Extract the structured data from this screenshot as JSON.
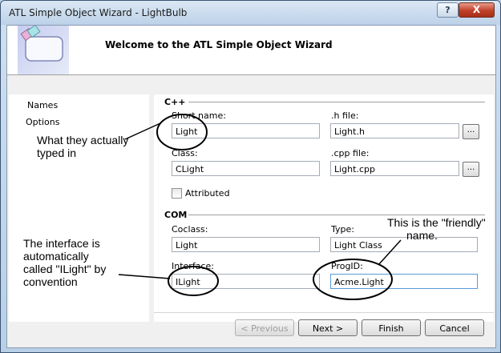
{
  "window": {
    "title": "ATL Simple Object Wizard - LightBulb",
    "help_label": "?",
    "close_label": "X"
  },
  "banner": {
    "title": "Welcome to the ATL Simple Object Wizard"
  },
  "nav": {
    "items": [
      "Names",
      "Options"
    ]
  },
  "cpp": {
    "section": "C++",
    "short_name": {
      "label": "Short name:",
      "value": "Light"
    },
    "h_file": {
      "label": ".h file:",
      "value": "Light.h",
      "browse": "..."
    },
    "class": {
      "label": "Class:",
      "value": "CLight"
    },
    "cpp_file": {
      "label": ".cpp file:",
      "value": "Light.cpp",
      "browse": "..."
    },
    "attributed": {
      "label": "Attributed",
      "checked": false
    }
  },
  "com": {
    "section": "COM",
    "coclass": {
      "label": "Coclass:",
      "value": "Light"
    },
    "type": {
      "label": "Type:",
      "value": "Light Class"
    },
    "interface": {
      "label": "Interface:",
      "value": "ILight"
    },
    "progid": {
      "label": "ProgID:",
      "value": "Acme.Light"
    }
  },
  "buttons": {
    "previous": "< Previous",
    "next": "Next >",
    "finish": "Finish",
    "cancel": "Cancel"
  },
  "annotations": {
    "typed": [
      "What they actually",
      "typed in"
    ],
    "friendly": [
      "This is the \"friendly\"",
      "name."
    ],
    "interface": [
      "The interface is",
      "automatically",
      "called \"ILight\" by",
      "convention"
    ]
  },
  "colors": {
    "annotation_ink": "#000000",
    "close_button": "#c0402a",
    "title_bar": "#bcd1e8"
  }
}
